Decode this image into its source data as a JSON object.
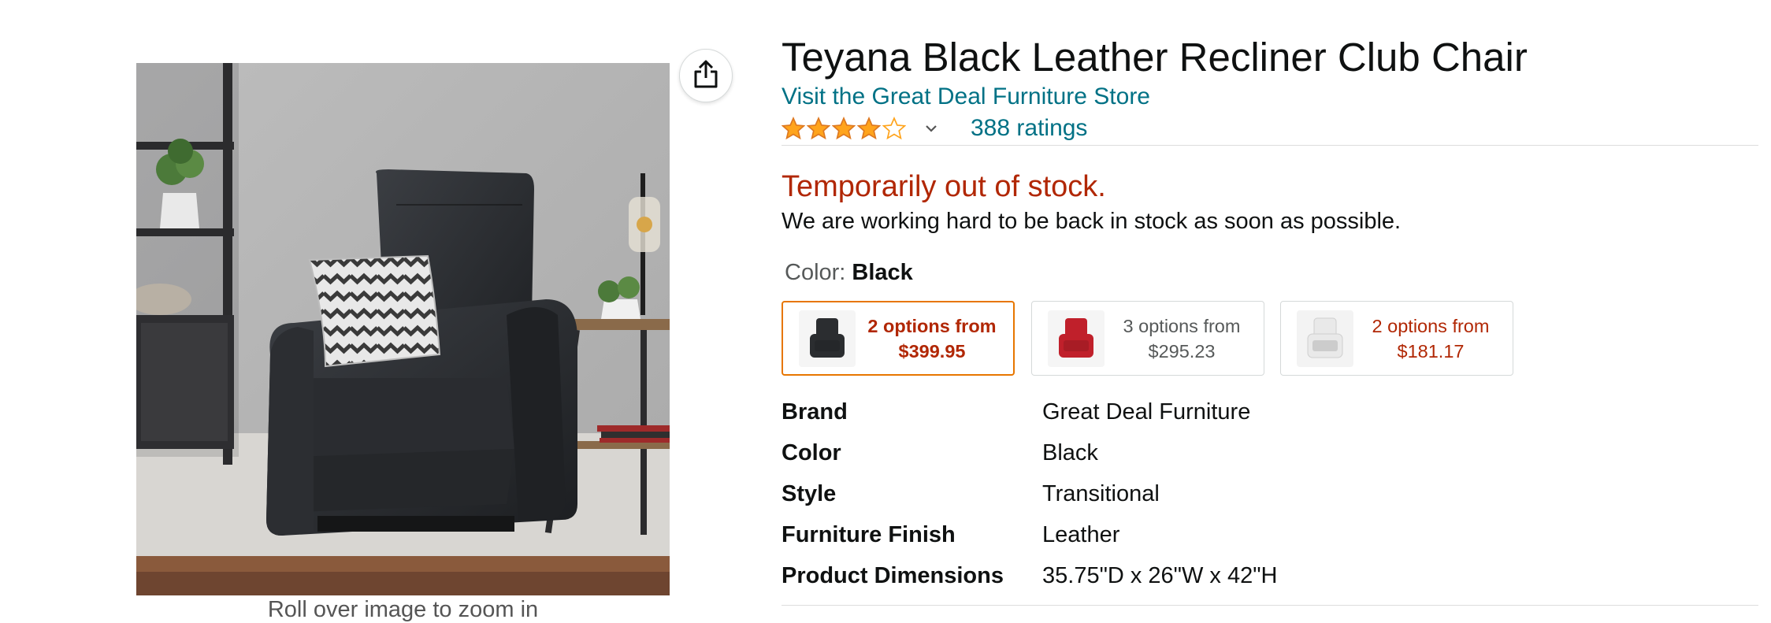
{
  "product": {
    "title": "Teyana Black Leather Recliner Club Chair",
    "store_link": "Visit the Great Deal Furniture Store",
    "rating": 4.0,
    "ratings_count": "388 ratings",
    "image_hint": "Roll over image to zoom in",
    "icons": {
      "share": "share-icon",
      "stars": "star-icon",
      "dropdown": "chevron-down-icon"
    }
  },
  "availability": {
    "status": "Temporarily out of stock.",
    "message": "We are working hard to be back in stock as soon as possible."
  },
  "color_selector": {
    "label": "Color:",
    "selected": "Black",
    "options": [
      {
        "line1": "2 options from",
        "line2": "$399.95",
        "selected": true,
        "thumb_color": "#2b2d30"
      },
      {
        "line1": "3 options from",
        "line2": "$295.23",
        "selected": false,
        "thumb_color": "#c0202b"
      },
      {
        "line1": "2 options from",
        "line2": "$181.17",
        "selected": false,
        "thumb_color": "#e9e9e9"
      }
    ]
  },
  "specs": [
    {
      "key": "Brand",
      "value": "Great Deal Furniture"
    },
    {
      "key": "Color",
      "value": "Black"
    },
    {
      "key": "Style",
      "value": "Transitional"
    },
    {
      "key": "Furniture Finish",
      "value": "Leather"
    },
    {
      "key": "Product Dimensions",
      "value": "35.75\"D x 26\"W x 42\"H"
    }
  ],
  "colors": {
    "link": "#007185",
    "price_red": "#b12704",
    "star": "#ffa41c",
    "selected_border": "#e77600"
  }
}
